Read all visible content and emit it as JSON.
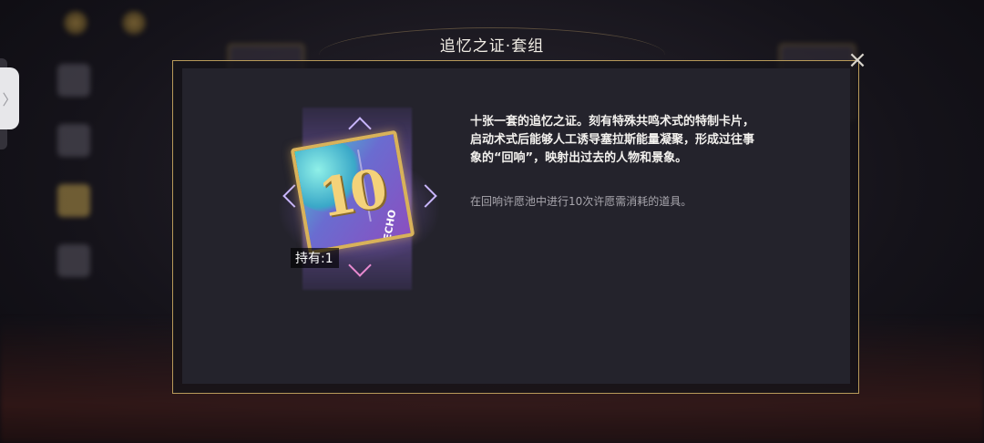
{
  "title": "追忆之证·套组",
  "item": {
    "card_number": "10",
    "card_tag": "ECHO",
    "owned_label": "持有:1"
  },
  "description": "十张一套的追忆之证。刻有特殊共鸣术式的特制卡片，启动术式后能够人工诱导塞拉斯能量凝聚，形成过往事象的“回响”，映射出过去的人物和景象。",
  "usage": "在回响许愿池中进行10次许愿需消耗的道具。",
  "icons": {
    "close": "close-icon",
    "side_tab": "chevron-right-icon"
  },
  "colors": {
    "frame_gold": "#b89a5a",
    "panel": "#24232c"
  }
}
